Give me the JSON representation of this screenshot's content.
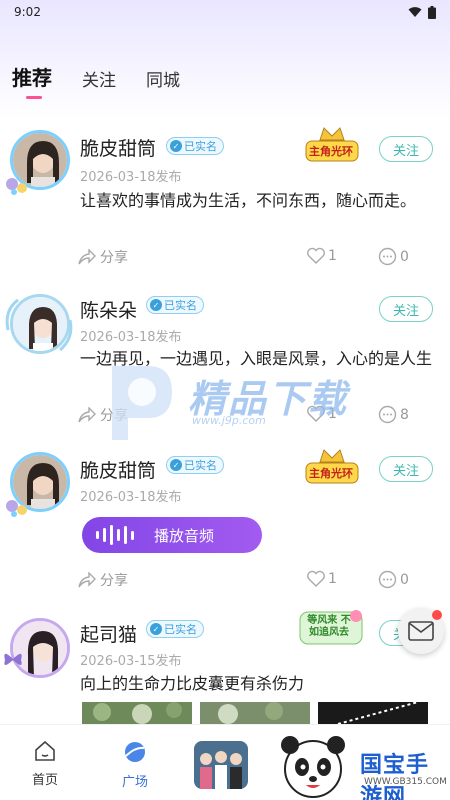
{
  "status_bar": {
    "time": "9:02"
  },
  "tabs": [
    "推荐",
    "关注",
    "同城"
  ],
  "verified_label": "已实名",
  "follow_label": "关注",
  "share_label": "分享",
  "posts": [
    {
      "username": "脆皮甜筒",
      "date": "2026-03-18发布",
      "content": "让喜欢的事情成为生活，不问东西，随心而走。",
      "likes": "1",
      "comments": "0",
      "badge": "主角光环"
    },
    {
      "username": "陈朵朵",
      "date": "2026-03-18发布",
      "content": "一边再见，一边遇见，入眼是风景，入心的是人生",
      "likes": "1",
      "comments": "8"
    },
    {
      "username": "脆皮甜筒",
      "date": "2026-03-18发布",
      "audio_label": "播放音频",
      "likes": "1",
      "comments": "0",
      "badge": "主角光环"
    },
    {
      "username": "起司猫",
      "date": "2026-03-15发布",
      "content": "向上的生命力比皮囊更有杀伤力",
      "badge": "等风来 不如追风去"
    }
  ],
  "watermark": {
    "text": "精品下载",
    "url": "www.j9p.com"
  },
  "bottom_nav": {
    "home": "首页",
    "square": "广场"
  },
  "logo_watermark": {
    "text": "国宝手游网",
    "url": "WWW.GB315.COM"
  },
  "colors": {
    "accent_pink": "#ff4f95",
    "audio_purple": "#8a4be8",
    "follow_teal": "#3cb8b0",
    "nav_active": "#3a6fd8"
  }
}
